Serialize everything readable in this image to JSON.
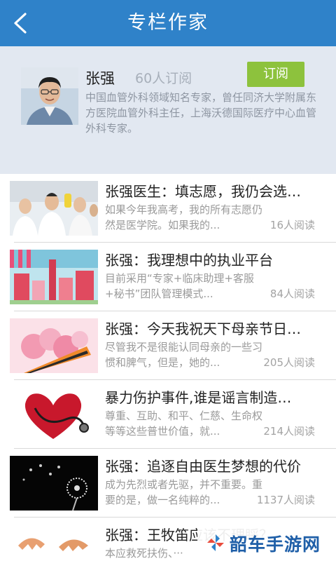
{
  "header": {
    "title": "专栏作家",
    "back_icon": "chevron-left-icon"
  },
  "author": {
    "name": "张强",
    "subscriber_count": "60人订阅",
    "subscribe_label": "订阅",
    "bio": "中国血管外科领域知名专家，曾任同济大学附属东方医院血管外科主任，上海沃德国际医疗中心血管外科专家。"
  },
  "articles": [
    {
      "title": "张强医生：填志愿，我仍会选…",
      "excerpt": "如果今年我高考，我的所有志愿仍然是医学院。如果我的...",
      "reads": "16人阅读",
      "thumb": "doctors-lab-photo"
    },
    {
      "title": "张强：我理想中的执业平台",
      "excerpt": "目前采用“专家+临床助理+客服+秘书”团队管理模式...",
      "reads": "84人阅读",
      "thumb": "city-illustration"
    },
    {
      "title": "张强：今天我祝天下母亲节日…",
      "excerpt": "尽管我不是很能认同母亲的一些习惯和脾气，但是，她的...",
      "reads": "205人阅读",
      "thumb": "carnation-flowers"
    },
    {
      "title": "暴力伤护事件,谁是谣言制造…",
      "excerpt": "尊重、互助、和平、仁慈、生命权等等这些普世价值，就...",
      "reads": "214人阅读",
      "thumb": "heart-stethoscope"
    },
    {
      "title": "张强：追逐自由医生梦想的代价",
      "excerpt": "成为先烈或者先驱，并不重要。重要的是，做一名纯粹的...",
      "reads": "1137人阅读",
      "thumb": "dandelion-night"
    },
    {
      "title": "张强：王牧笛应该不理睬？",
      "excerpt": "本应救死扶伤、···",
      "reads": "",
      "thumb": "broken-eggshells"
    }
  ],
  "watermark": {
    "text": "韶车手游网",
    "logo_icon": "pinwheel-logo-icon"
  },
  "colors": {
    "header_blue": "#2f82c9",
    "subscribe_green": "#8dc23d",
    "panel_bg": "#e2e8f1"
  }
}
